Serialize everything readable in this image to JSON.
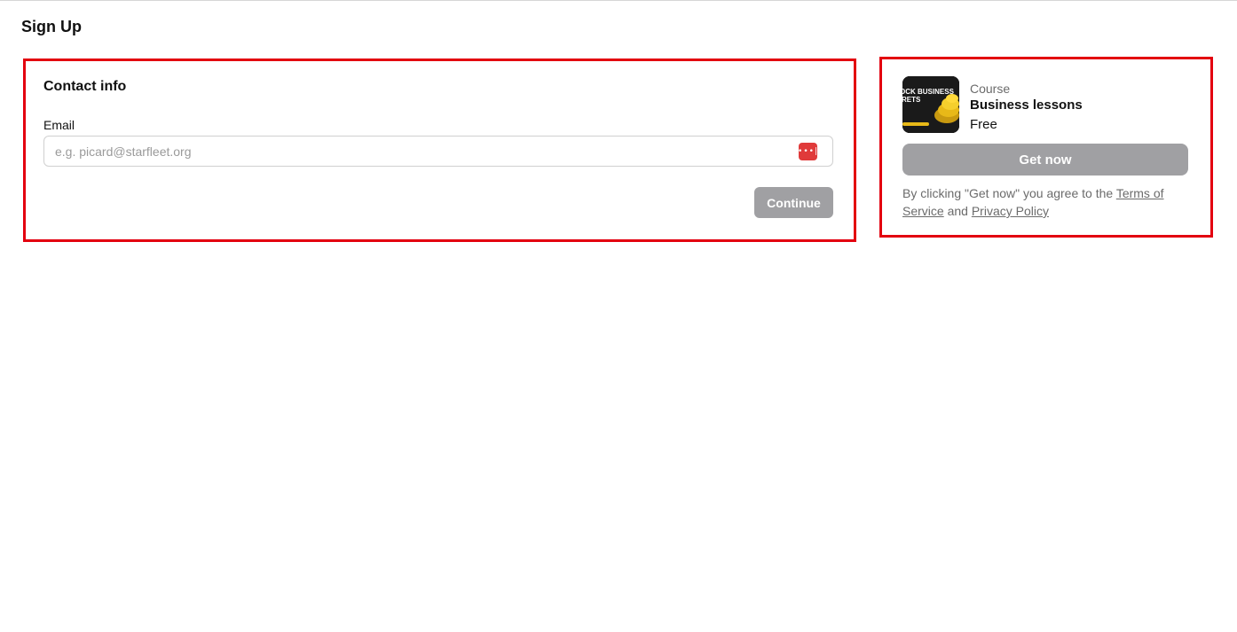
{
  "page": {
    "title": "Sign Up"
  },
  "contact": {
    "heading": "Contact info",
    "email_label": "Email",
    "email_placeholder": "e.g. picard@starfleet.org",
    "email_value": "",
    "password_manager_icon": "password-manager-icon",
    "continue_label": "Continue"
  },
  "product": {
    "thumbnail_text_line1": "OCK BUSINESS",
    "thumbnail_text_line2": "RETS",
    "type": "Course",
    "name": "Business lessons",
    "price": "Free",
    "cta_label": "Get now",
    "legal_prefix": "By clicking \"Get now\" you agree to the ",
    "terms_label": "Terms of Service",
    "legal_middle": " and ",
    "privacy_label": "Privacy Policy"
  },
  "colors": {
    "highlight_border": "#e3000f",
    "button_disabled": "#a0a0a3",
    "password_manager": "#e03a3a"
  }
}
